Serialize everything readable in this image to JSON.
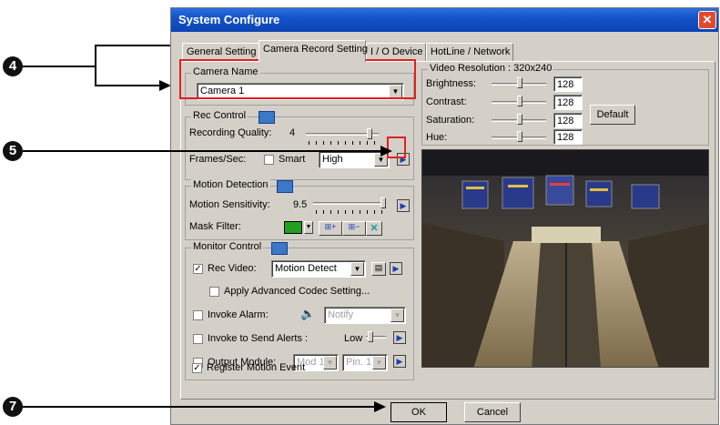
{
  "window": {
    "title": "System Configure",
    "close_glyph": "✕"
  },
  "tabs": [
    "General Setting",
    "Camera Record Setting",
    "I / O Device",
    "HotLine / Network"
  ],
  "camera_name": {
    "title": "Camera Name",
    "value": "Camera 1"
  },
  "rec_control": {
    "title": "Rec Control",
    "quality_label": "Recording Quality:",
    "quality_value": "4",
    "quality_level": 0.88,
    "frames_label": "Frames/Sec:",
    "smart_label": "Smart",
    "fps_value": "High"
  },
  "motion_detection": {
    "title": "Motion Detection",
    "sensitivity_label": "Motion Sensitivity:",
    "sensitivity_value": "9.5",
    "sensitivity_level": 0.95,
    "mask_label": "Mask Filter:",
    "mask_color": "#22a020"
  },
  "monitor_control": {
    "title": "Monitor Control",
    "rec_video_label": "Rec Video:",
    "rec_video_value": "Motion Detect",
    "advanced_codec_label": "Apply Advanced Codec Setting...",
    "invoke_alarm_label": "Invoke Alarm:",
    "alarm_value": "Notify",
    "send_alerts_label": "Invoke to Send Alerts :",
    "alerts_level": "Low",
    "output_module_label": "Output Module:",
    "module_value": "Mod 1",
    "pin_value": "Pin. 1",
    "register_motion_label": "Register Motion Event"
  },
  "video": {
    "resolution_label": "Video Resolution : 320x240",
    "brightness_label": "Brightness:",
    "brightness_value": "128",
    "contrast_label": "Contrast:",
    "contrast_value": "128",
    "saturation_label": "Saturation:",
    "saturation_value": "128",
    "hue_label": "Hue:",
    "hue_value": "128",
    "default_label": "Default"
  },
  "buttons": {
    "ok": "OK",
    "cancel": "Cancel"
  },
  "callouts": {
    "c4": "4",
    "c5": "5",
    "c7": "7"
  },
  "colors": {
    "accent": "#0c43b3",
    "highlight": "#e02020"
  }
}
